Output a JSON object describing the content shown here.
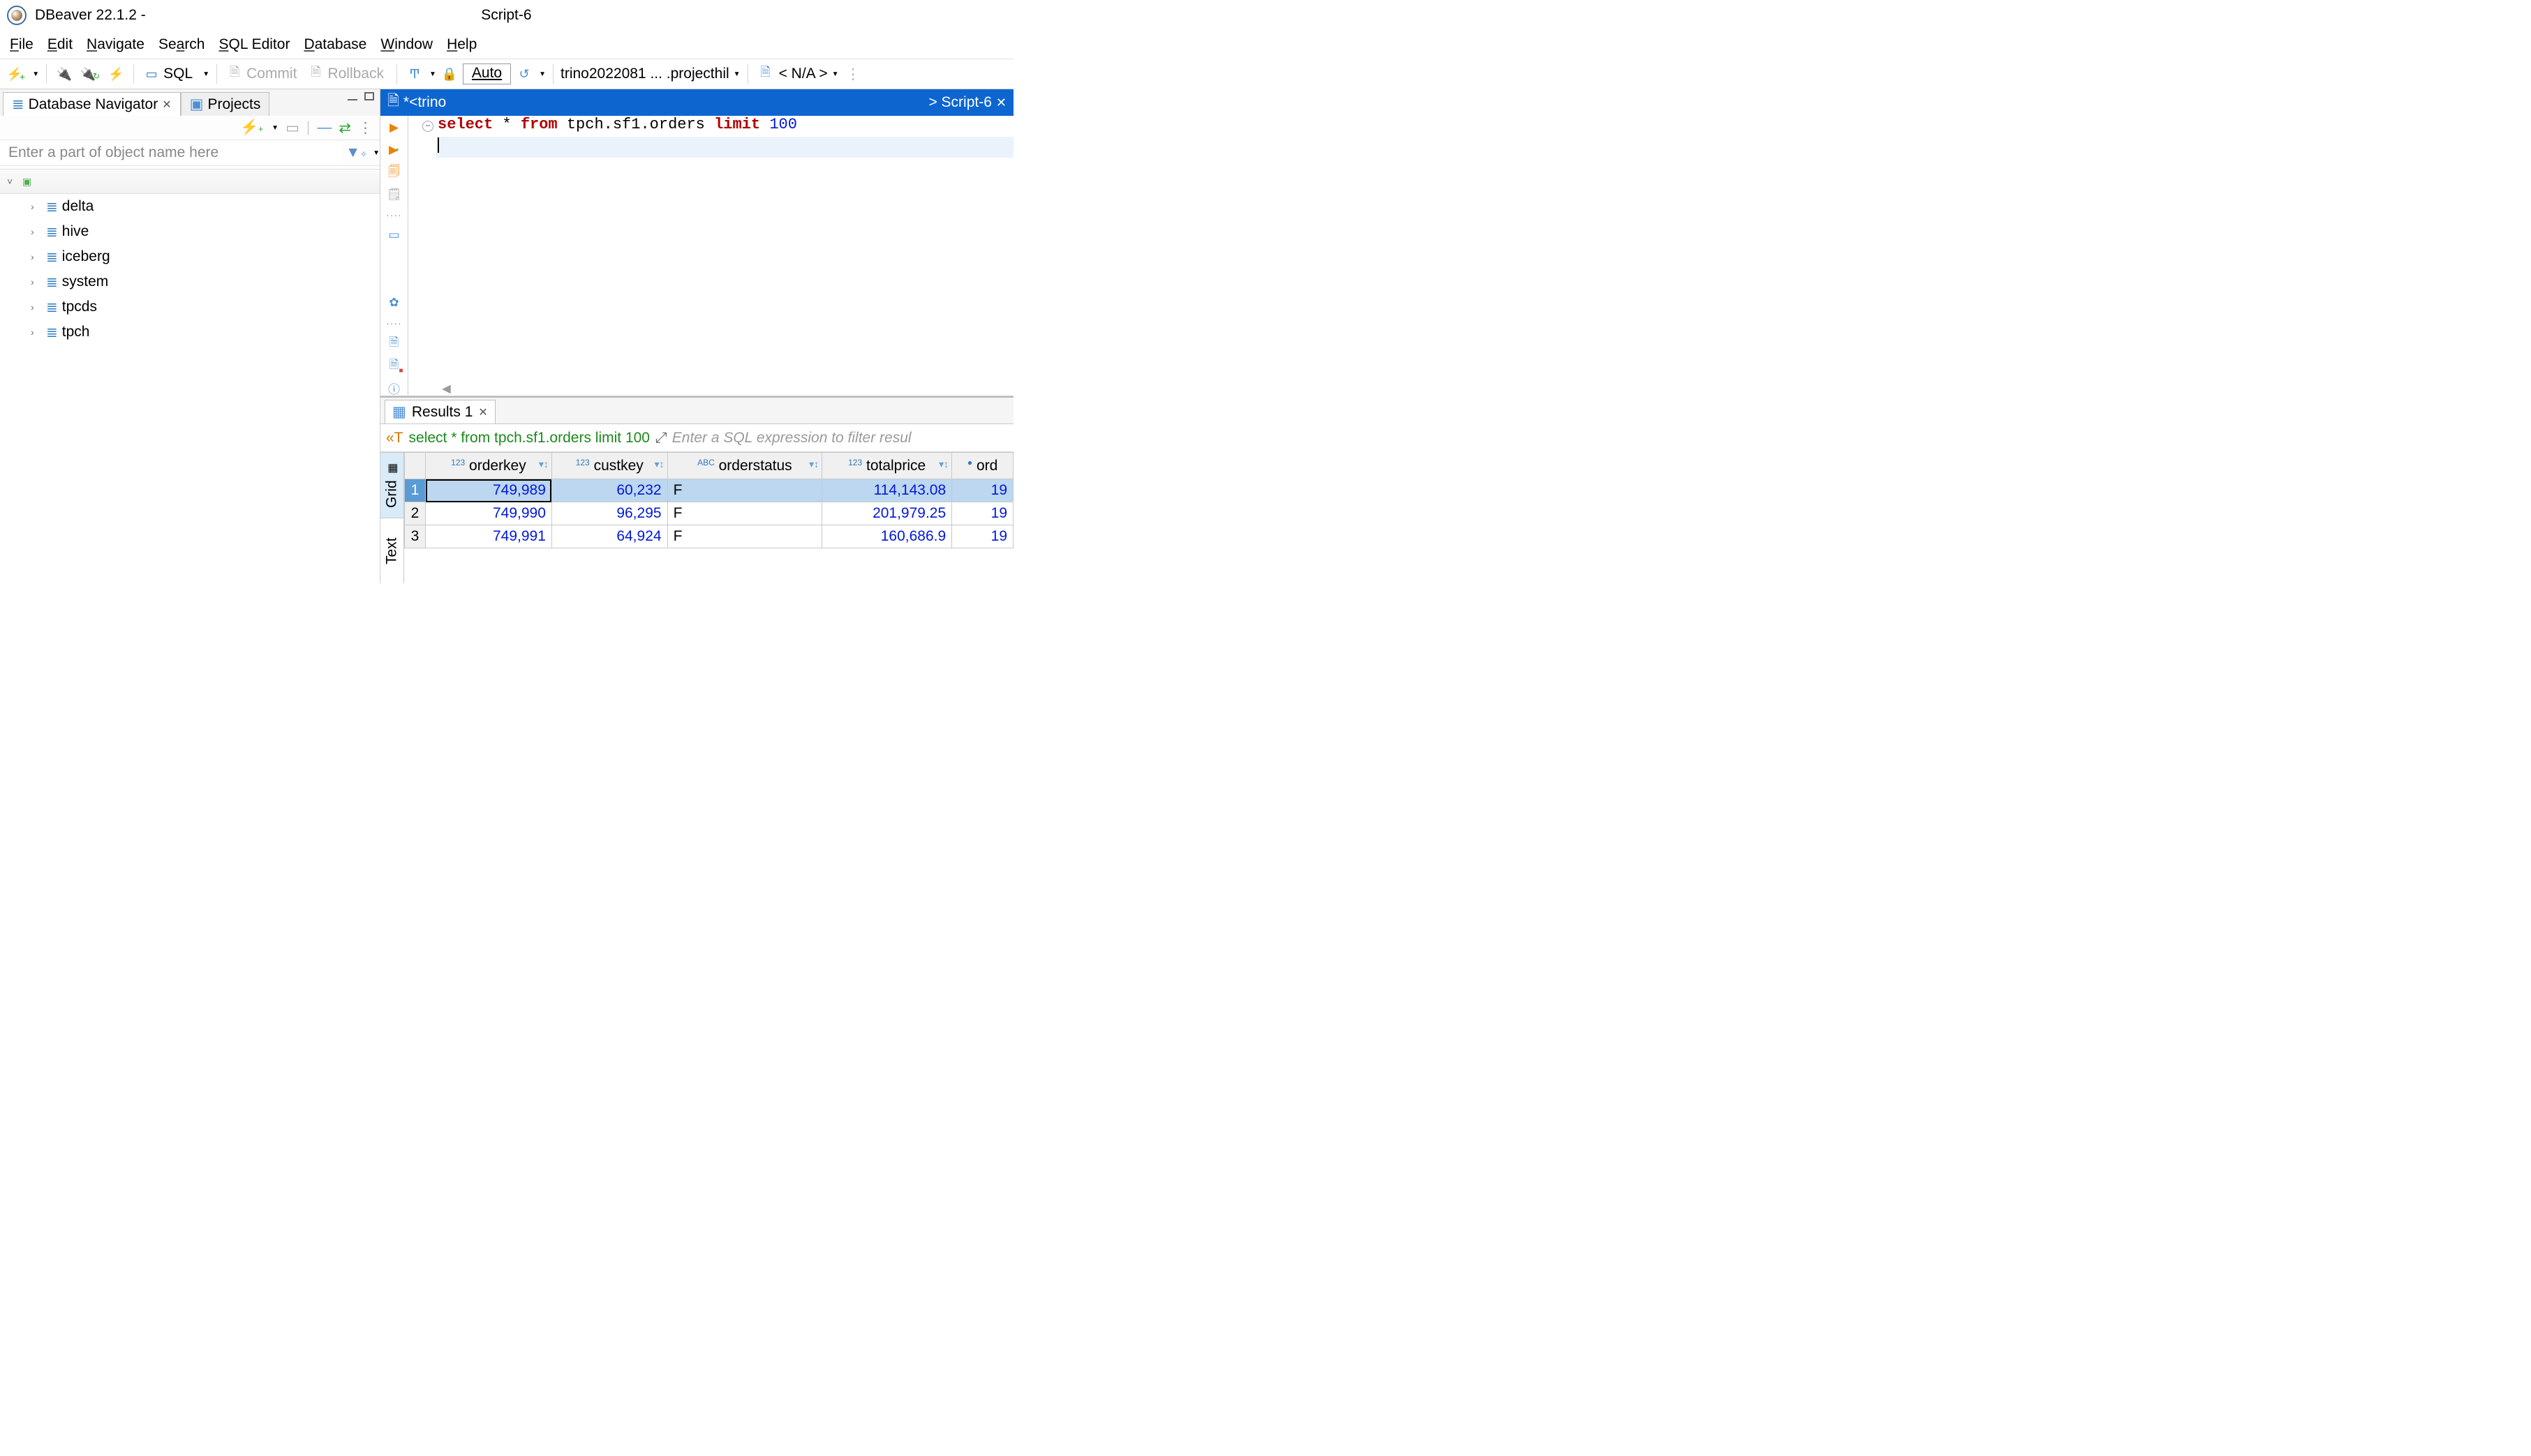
{
  "titlebar": {
    "app_name": "DBeaver 22.1.2 -",
    "subtitle": "Script-6"
  },
  "menu": {
    "file": "File",
    "edit": "Edit",
    "navigate": "Navigate",
    "search": "Search",
    "sql_editor": "SQL Editor",
    "database": "Database",
    "window": "Window",
    "help": "Help"
  },
  "toolbar": {
    "sql_label": "SQL",
    "commit": "Commit",
    "rollback": "Rollback",
    "auto": "Auto",
    "connection": "trino2022081 ... .projecthil",
    "schema": "< N/A >"
  },
  "left": {
    "tab_navigator": "Database Navigator",
    "tab_projects": "Projects",
    "filter_placeholder": "Enter a part of object name here",
    "catalogs": [
      "delta",
      "hive",
      "iceberg",
      "system",
      "tpcds",
      "tpch"
    ]
  },
  "editor": {
    "tab_left": "*<trino",
    "tab_right": "> Script-6",
    "sql": {
      "kw_select": "select",
      "star": "*",
      "kw_from": "from",
      "table": "tpch.sf1.orders",
      "kw_limit": "limit",
      "limit_n": "100"
    }
  },
  "results": {
    "tab": "Results 1",
    "query": "select * from tpch.sf1.orders limit 100",
    "filter_hint": "Enter a SQL expression to filter resul",
    "side": {
      "grid": "Grid",
      "text": "Text"
    },
    "columns": [
      {
        "type": "123",
        "name": "orderkey"
      },
      {
        "type": "123",
        "name": "custkey"
      },
      {
        "type": "ABC",
        "name": "orderstatus"
      },
      {
        "type": "123",
        "name": "totalprice"
      },
      {
        "type": "⏱",
        "name": "ord"
      }
    ],
    "rows": [
      {
        "n": "1",
        "orderkey": "749,989",
        "custkey": "60,232",
        "orderstatus": "F",
        "totalprice": "114,143.08",
        "ord": "19"
      },
      {
        "n": "2",
        "orderkey": "749,990",
        "custkey": "96,295",
        "orderstatus": "F",
        "totalprice": "201,979.25",
        "ord": "19"
      },
      {
        "n": "3",
        "orderkey": "749,991",
        "custkey": "64,924",
        "orderstatus": "F",
        "totalprice": "160,686.9",
        "ord": "19"
      }
    ]
  }
}
